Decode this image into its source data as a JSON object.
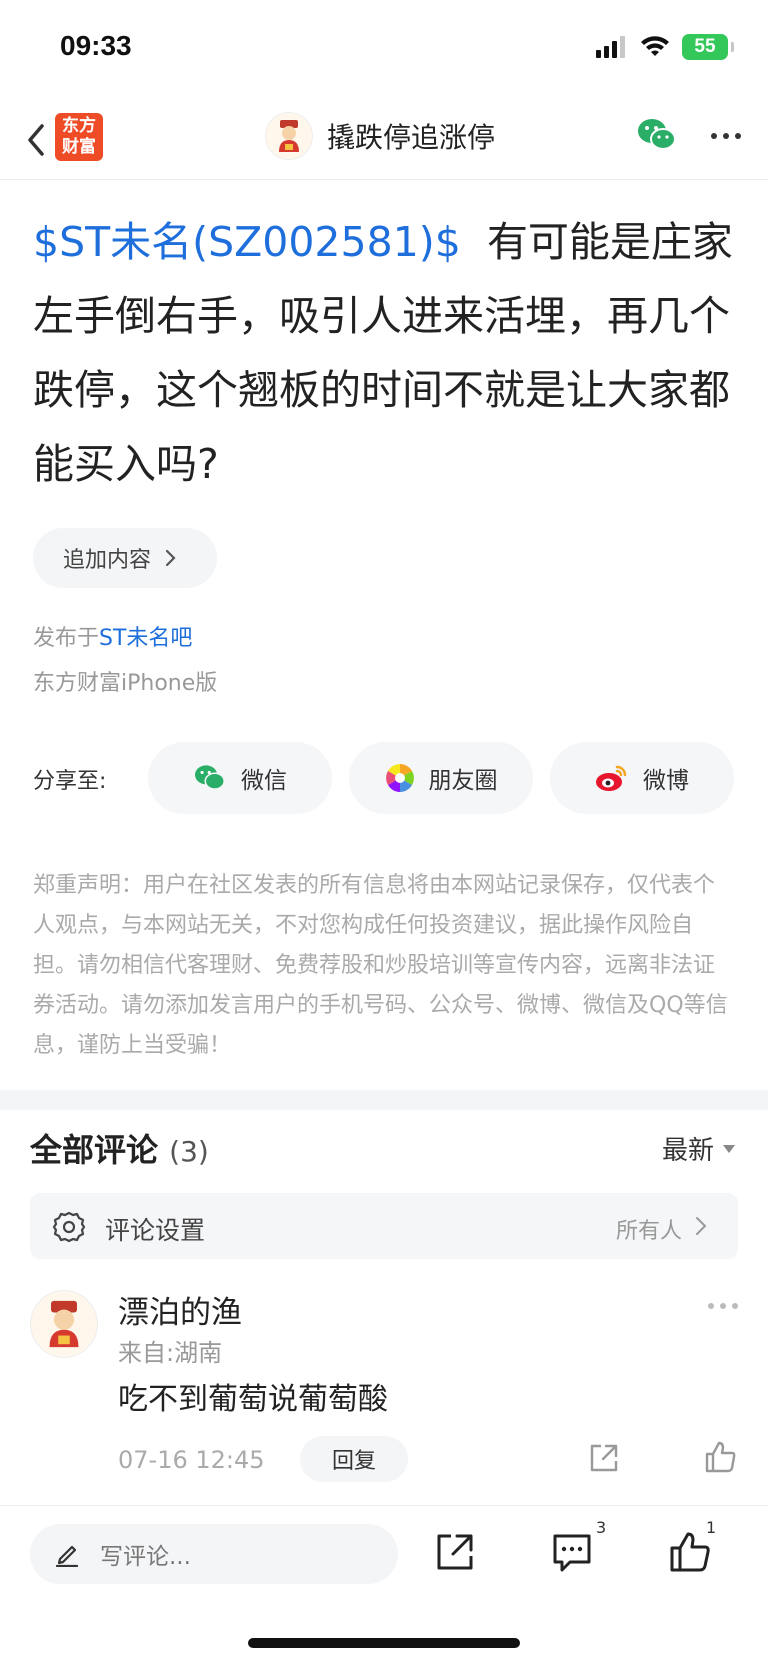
{
  "status_bar": {
    "time": "09:33",
    "battery": "55",
    "icons": [
      "signal-icon",
      "wifi-icon",
      "battery-icon"
    ]
  },
  "nav": {
    "back_icon": "back-chevron-icon",
    "logo_text_line1": "东方",
    "logo_text_line2": "财富",
    "title": "撬跌停追涨停",
    "wechat_icon": "wechat-icon",
    "more_icon": "more-icon"
  },
  "post": {
    "stock_tag": "$ST未名(SZ002581)$",
    "body": "有可能是庄家左手倒右手，吸引人进来活埋，再几个跌停，这个翘板的时间不就是让大家都能买入吗?",
    "append_label": "追加内容",
    "posted_in_prefix": "发布于",
    "posted_in_bar": "ST未名吧",
    "client": "东方财富iPhone版"
  },
  "share": {
    "label": "分享至:",
    "options": [
      {
        "label": "微信",
        "icon": "wechat-icon"
      },
      {
        "label": "朋友圈",
        "icon": "moments-icon"
      },
      {
        "label": "微博",
        "icon": "weibo-icon"
      }
    ]
  },
  "disclaimer": "郑重声明：用户在社区发表的所有信息将由本网站记录保存，仅代表个人观点，与本网站无关，不对您构成任何投资建议，据此操作风险自担。请勿相信代客理财、免费荐股和炒股培训等宣传内容，远离非法证券活动。请勿添加发言用户的手机号码、公众号、微博、微信及QQ等信息，谨防上当受骗！",
  "comments": {
    "title": "全部评论",
    "count": "(3)",
    "sort_label": "最新",
    "settings_label": "评论设置",
    "settings_value": "所有人",
    "items": [
      {
        "author": "漂泊的渔",
        "location": "来自:湖南",
        "text": "吃不到葡萄说葡萄酸",
        "time": "07-16 12:45",
        "reply_label": "回复"
      }
    ]
  },
  "bottom_bar": {
    "input_placeholder": "写评论...",
    "comment_count": "3",
    "like_count": "1"
  },
  "colors": {
    "link_blue": "#1e6fdc",
    "brand_orange": "#ee4b27",
    "battery_green": "#34c759",
    "wechat_green": "#2aae67"
  }
}
